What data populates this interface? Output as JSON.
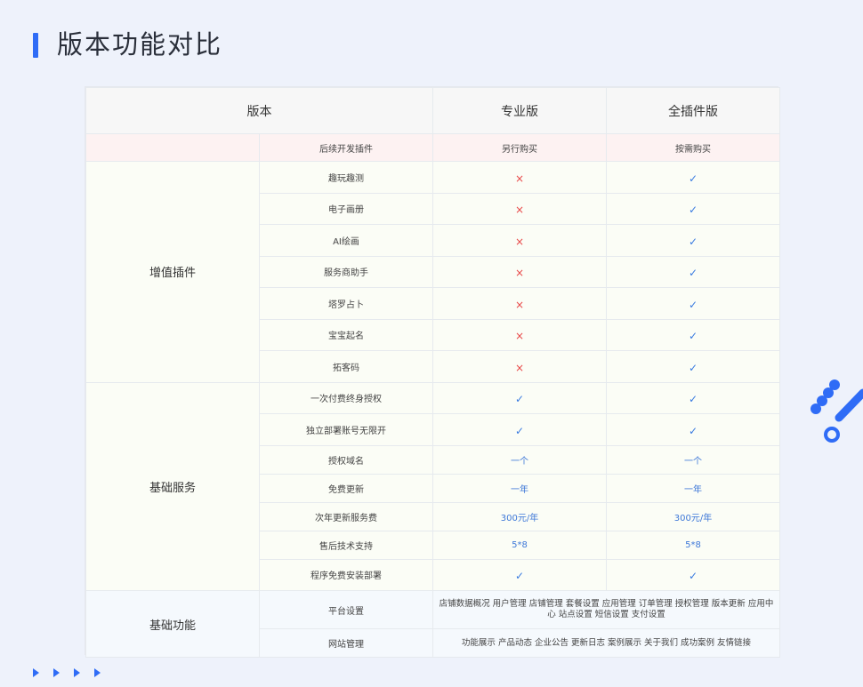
{
  "title": "版本功能对比",
  "table": {
    "headers": [
      "版本",
      "专业版",
      "全插件版"
    ],
    "dev": {
      "feature": "后续开发插件",
      "pro": "另行购买",
      "full": "按需购买"
    },
    "groups": [
      {
        "name": "增值插件",
        "rows": [
          {
            "feature": "趣玩趣测",
            "pro": "×",
            "full": "✓"
          },
          {
            "feature": "电子画册",
            "pro": "×",
            "full": "✓"
          },
          {
            "feature": "AI绘画",
            "pro": "×",
            "full": "✓"
          },
          {
            "feature": "服务商助手",
            "pro": "×",
            "full": "✓"
          },
          {
            "feature": "塔罗占卜",
            "pro": "×",
            "full": "✓"
          },
          {
            "feature": "宝宝起名",
            "pro": "×",
            "full": "✓"
          },
          {
            "feature": "拓客码",
            "pro": "×",
            "full": "✓"
          }
        ]
      },
      {
        "name": "基础服务",
        "rows": [
          {
            "feature": "一次付费终身授权",
            "pro": "✓",
            "full": "✓"
          },
          {
            "feature": "独立部署账号无限开",
            "pro": "✓",
            "full": "✓"
          },
          {
            "feature": "授权域名",
            "pro": "一个",
            "full": "一个"
          },
          {
            "feature": "免费更新",
            "pro": "一年",
            "full": "一年"
          },
          {
            "feature": "次年更新服务费",
            "pro": "300元/年",
            "full": "300元/年"
          },
          {
            "feature": "售后技术支持",
            "pro": "5*8",
            "full": "5*8"
          },
          {
            "feature": "程序免费安装部署",
            "pro": "✓",
            "full": "✓"
          }
        ]
      },
      {
        "name": "基础功能",
        "rows": [
          {
            "feature": "平台设置",
            "value": "店铺数据概况 用户管理 店铺管理 套餐设置 应用管理 订单管理 授权管理 版本更新 应用中心 站点设置 短信设置 支付设置"
          },
          {
            "feature": "网站管理",
            "value": "功能展示 产品动态 企业公告 更新日志 案例展示 关于我们 成功案例 友情链接"
          }
        ]
      }
    ]
  },
  "icons": {
    "cross": "cross-icon",
    "check": "check-icon"
  },
  "colors": {
    "accent": "#2f6cf6",
    "cross": "#e84a4a",
    "check": "#3a7be0"
  }
}
